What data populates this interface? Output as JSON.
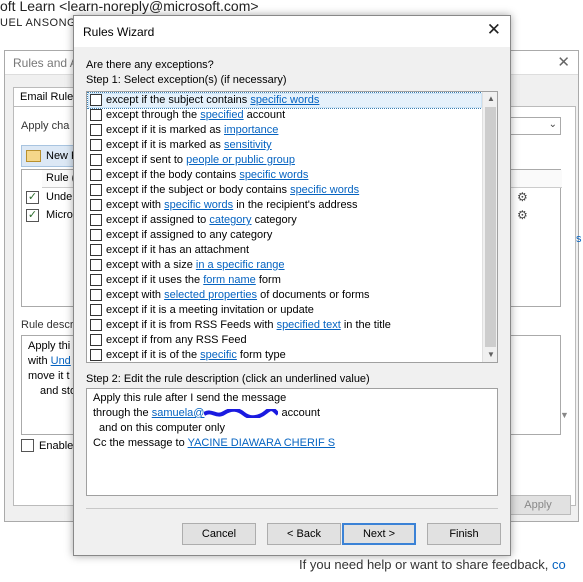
{
  "background": {
    "from": "oft Learn <learn-noreply@microsoft.com>",
    "to": "UEL ANSONG",
    "feedback_text": "If you need help or want to share feedback, ",
    "feedback_link": "co"
  },
  "rules_alerts": {
    "title": "Rules and A",
    "tab": "Email Rule",
    "apply_changes": "Apply cha",
    "new_rule": "New R",
    "list_header": "Rule (a",
    "rows": [
      {
        "label": "Undeli",
        "checked": "✓"
      },
      {
        "label": "Micros",
        "checked": "✓"
      }
    ],
    "desc_label": "Rule descr",
    "desc_lines": [
      "Apply thi",
      "with ",
      "move it t",
      "and sto"
    ],
    "desc_link": "Und",
    "enable_label": "Enable",
    "apply_button": "Apply",
    "side_letter": "s"
  },
  "wizard": {
    "title": "Rules Wizard",
    "question": "Are there any exceptions?",
    "step1": "Step 1: Select exception(s) (if necessary)",
    "exceptions": [
      {
        "pre": "except if the subject contains ",
        "link": "specific words",
        "post": ""
      },
      {
        "pre": "except through the ",
        "link": "specified",
        "post": " account"
      },
      {
        "pre": "except if it is marked as ",
        "link": "importance",
        "post": ""
      },
      {
        "pre": "except if it is marked as ",
        "link": "sensitivity",
        "post": ""
      },
      {
        "pre": "except if sent to ",
        "link": "people or public group",
        "post": ""
      },
      {
        "pre": "except if the body contains ",
        "link": "specific words",
        "post": ""
      },
      {
        "pre": "except if the subject or body contains ",
        "link": "specific words",
        "post": ""
      },
      {
        "pre": "except with ",
        "link": "specific words",
        "post": " in the recipient's address"
      },
      {
        "pre": "except if assigned to ",
        "link": "category",
        "post": " category"
      },
      {
        "pre": "except if assigned to any category",
        "link": "",
        "post": ""
      },
      {
        "pre": "except if it has an attachment",
        "link": "",
        "post": ""
      },
      {
        "pre": "except with a size ",
        "link": "in a specific range",
        "post": ""
      },
      {
        "pre": "except if it uses the ",
        "link": "form name",
        "post": " form"
      },
      {
        "pre": "except with ",
        "link": "selected properties",
        "post": " of documents or forms"
      },
      {
        "pre": "except if it is a meeting invitation or update",
        "link": "",
        "post": ""
      },
      {
        "pre": "except if it is from RSS Feeds with ",
        "link": "specified text",
        "post": " in the title"
      },
      {
        "pre": "except if from any RSS Feed",
        "link": "",
        "post": ""
      },
      {
        "pre": "except if it is of the ",
        "link": "specific",
        "post": " form type"
      }
    ],
    "step2": "Step 2: Edit the rule description (click an underlined value)",
    "desc": {
      "line1": "Apply this rule after I send the message",
      "line2_pre": "through the ",
      "line2_link": "samuela@",
      "line2_post": " account",
      "line3": "and on this computer only",
      "line4_pre": "Cc the message to ",
      "line4_link": "YACINE DIAWARA CHERIF S"
    },
    "buttons": {
      "cancel": "Cancel",
      "back": "< Back",
      "next": "Next >",
      "finish": "Finish"
    }
  }
}
